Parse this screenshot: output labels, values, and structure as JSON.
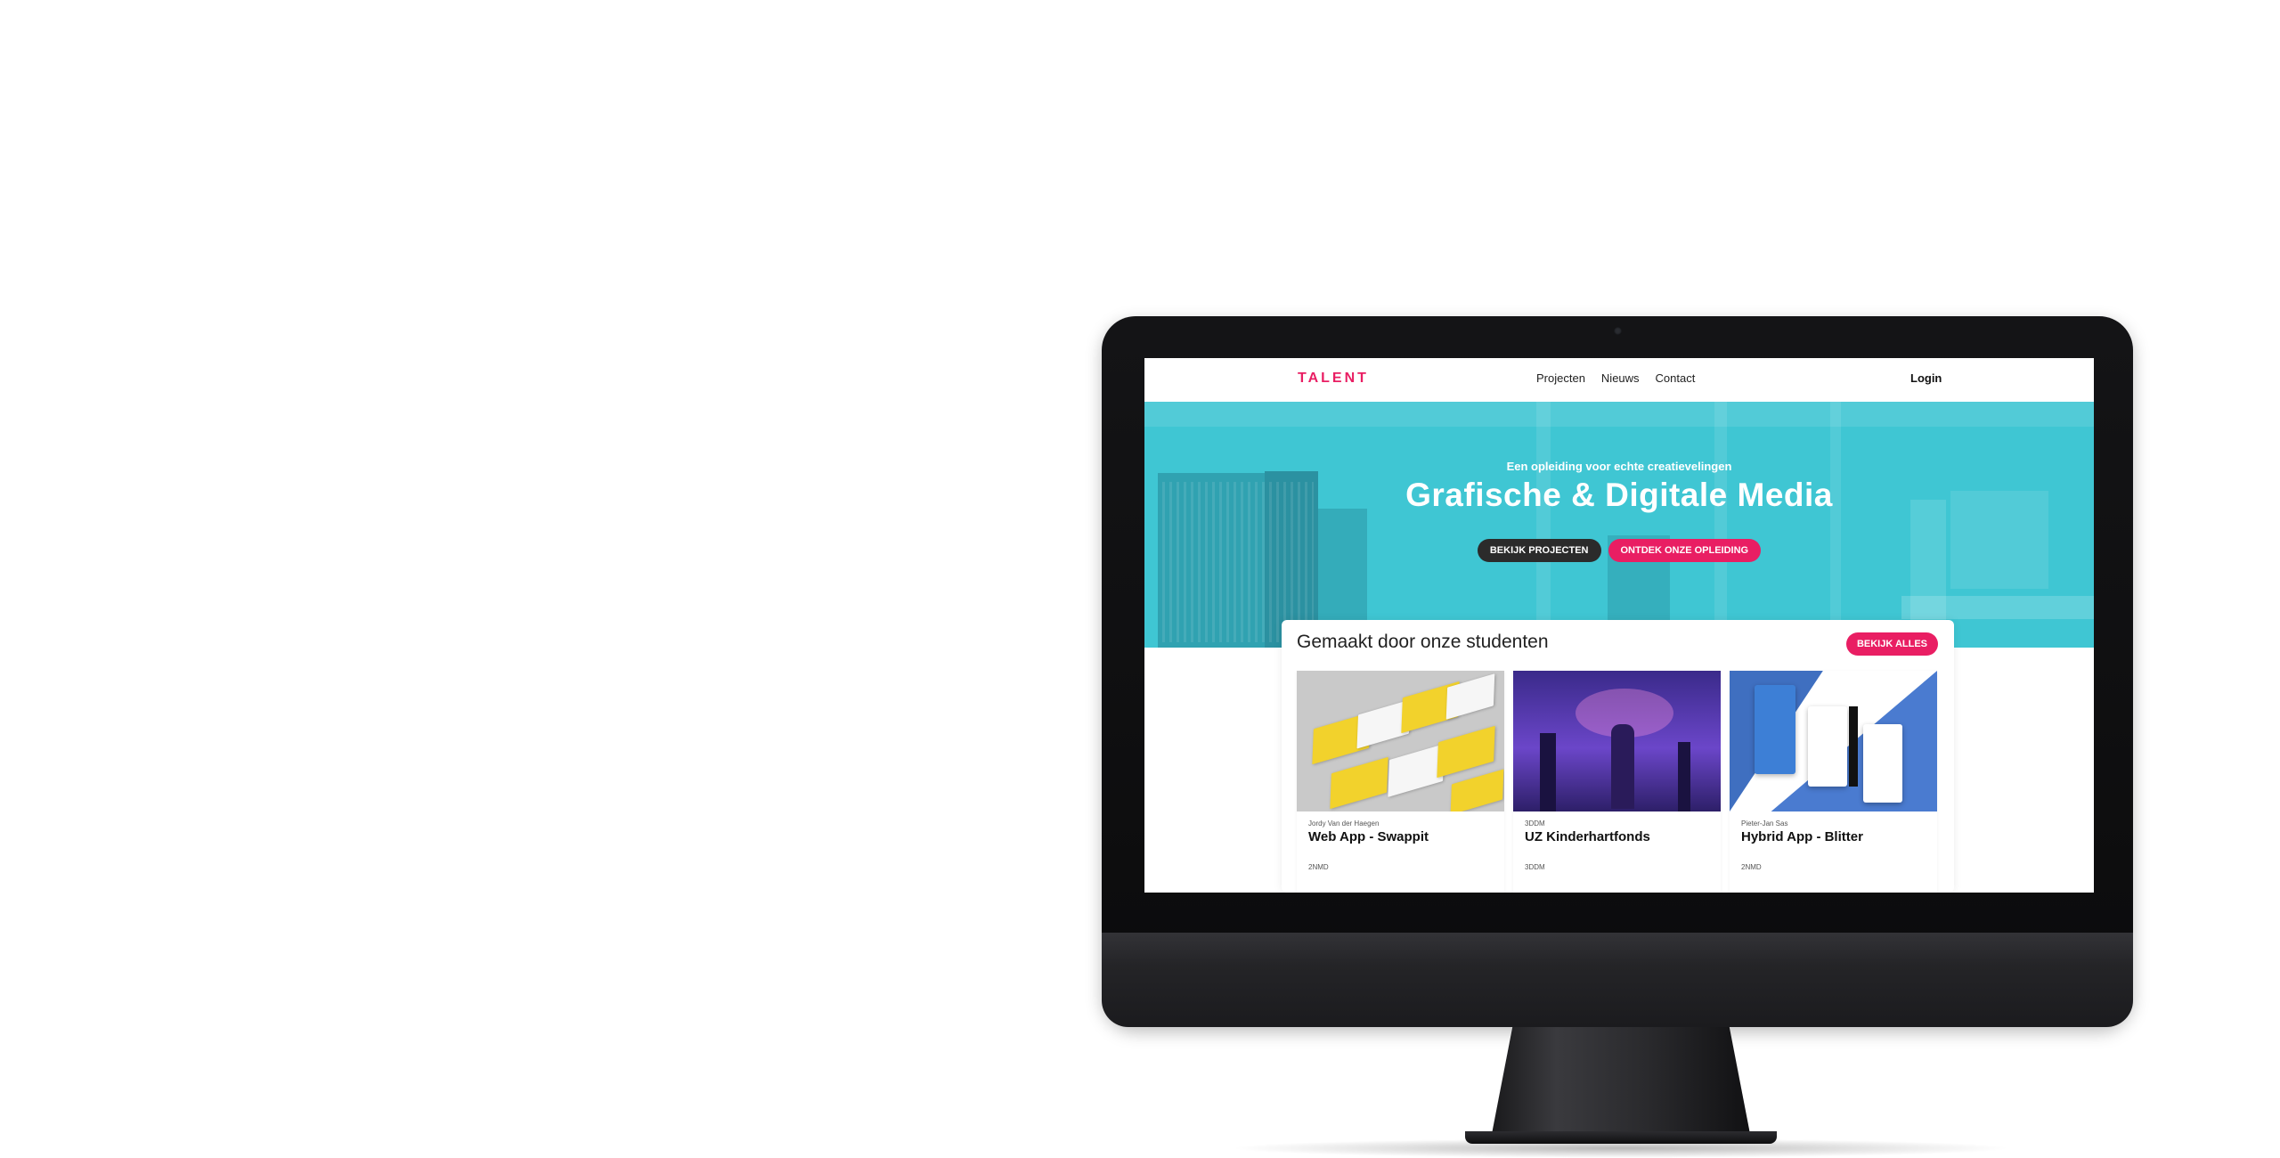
{
  "colors": {
    "brand_pink": "#e91e63",
    "hero_cyan": "#3fc6d3",
    "dark_button": "#2b2b2b"
  },
  "nav": {
    "logo": "TALENT",
    "links": [
      "Projecten",
      "Nieuws",
      "Contact"
    ],
    "login": "Login"
  },
  "hero": {
    "tagline": "Een opleiding voor echte creatievelingen",
    "title": "Grafische & Digitale Media",
    "primary_button": "BEKIJK PROJECTEN",
    "secondary_button": "ONTDEK ONZE OPLEIDING"
  },
  "projects": {
    "title": "Gemaakt door onze studenten",
    "view_all": "BEKIJK ALLES",
    "items": [
      {
        "author": "Jordy Van der Haegen",
        "title": "Web App - Swappit",
        "tag": "2NMD"
      },
      {
        "author": "3DDM",
        "title": "UZ Kinderhartfonds",
        "tag": "3DDM"
      },
      {
        "author": "Pieter-Jan Sas",
        "title": "Hybrid App - Blitter",
        "tag": "2NMD"
      }
    ]
  }
}
